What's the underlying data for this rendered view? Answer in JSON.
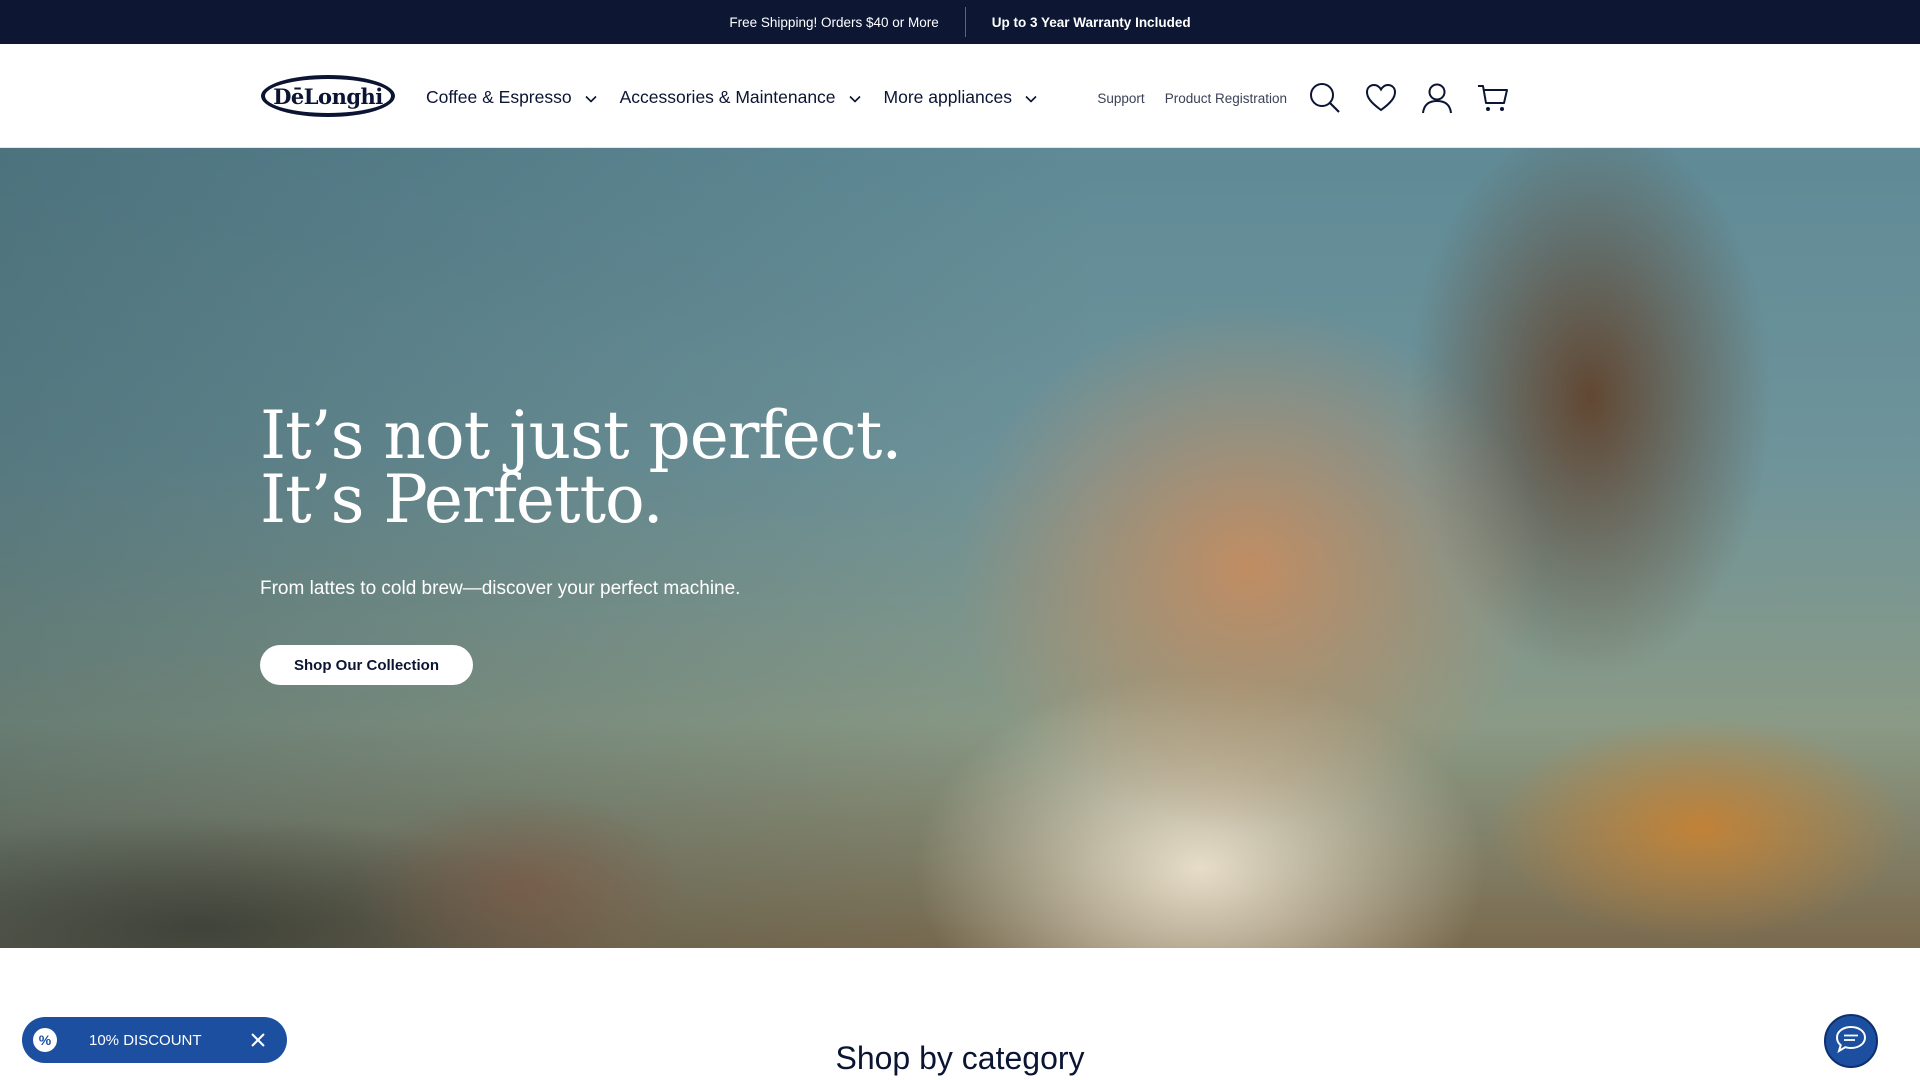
{
  "promo_bar": {
    "items": [
      "Free Shipping! Orders $40 or More",
      "Up to 3 Year Warranty Included"
    ]
  },
  "header": {
    "logo_text": "DēLonghi",
    "nav": [
      {
        "label": "Coffee & Espresso",
        "icon": "chevron-down-icon"
      },
      {
        "label": "Accessories & Maintenance",
        "icon": "chevron-down-icon"
      },
      {
        "label": "More appliances",
        "icon": "chevron-down-icon"
      }
    ],
    "utility_links": [
      "Support",
      "Product Registration"
    ],
    "utility_icons": [
      "search-icon",
      "heart-icon",
      "user-icon",
      "cart-icon"
    ]
  },
  "hero": {
    "title": "It’s not just perfect. It’s Perfetto.",
    "subtitle": "From lattes to cold brew—discover your perfect machine.",
    "cta_label": "Shop Our Collection"
  },
  "sections": {
    "category_heading": "Shop by category"
  },
  "discount": {
    "badge": "%",
    "label": "10% DISCOUNT",
    "close_icon": "close-icon"
  },
  "chat": {
    "icon": "chat-bubble-icon"
  },
  "colors": {
    "brand_navy": "#0d1733",
    "accent_blue": "#1c4fa0"
  }
}
